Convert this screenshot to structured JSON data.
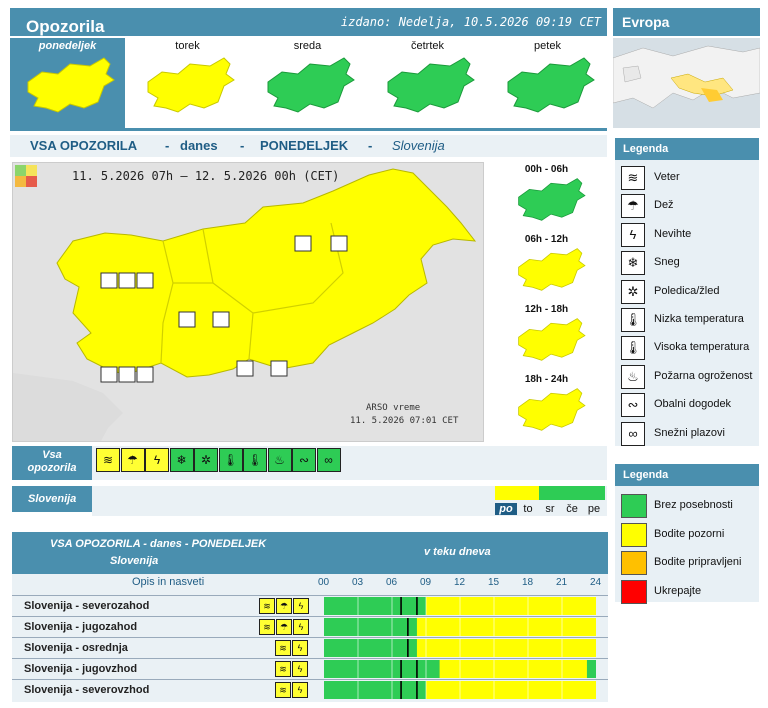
{
  "header": {
    "title": "Opozorila",
    "issued": "izdano: Nedelja, 10.5.2026 09:19 CET",
    "europe": "Evropa"
  },
  "days": [
    {
      "label": "ponedeljek",
      "level": "yellow"
    },
    {
      "label": "torek",
      "level": "yellow"
    },
    {
      "label": "sreda",
      "level": "green"
    },
    {
      "label": "četrtek",
      "level": "green"
    },
    {
      "label": "petek",
      "level": "green"
    }
  ],
  "region_header": {
    "a": "VSA OPOZORILA",
    "dash1": "-",
    "b": "danes",
    "dash2": "-",
    "c": "PONEDELJEK",
    "dash3": "-",
    "d": "Slovenija"
  },
  "map": {
    "period": "11. 5.2026 07h — 12. 5.2026 00h    (CET)",
    "source": "ARSO vreme",
    "source_time": "11. 5.2026  07:01 CET"
  },
  "slices": [
    {
      "label": "00h - 06h",
      "level": "green"
    },
    {
      "label": "06h - 12h",
      "level": "yellow"
    },
    {
      "label": "12h - 18h",
      "level": "yellow"
    },
    {
      "label": "18h - 24h",
      "level": "yellow"
    }
  ],
  "legend_types": {
    "title": "Legenda",
    "items": [
      {
        "icon": "wind-icon",
        "glyph": "≋",
        "label": "Veter"
      },
      {
        "icon": "rain-icon",
        "glyph": "☂",
        "label": "Dež"
      },
      {
        "icon": "thunderstorm-icon",
        "glyph": "ϟ",
        "label": "Nevihte"
      },
      {
        "icon": "snow-icon",
        "glyph": "❄",
        "label": "Sneg"
      },
      {
        "icon": "ice-icon",
        "glyph": "✲",
        "label": "Poledica/žled"
      },
      {
        "icon": "low-temp-icon",
        "glyph": "🌡",
        "label": "Nizka temperatura"
      },
      {
        "icon": "high-temp-icon",
        "glyph": "🌡",
        "label": "Visoka temperatura"
      },
      {
        "icon": "fire-icon",
        "glyph": "♨",
        "label": "Požarna ogroženost"
      },
      {
        "icon": "coastal-icon",
        "glyph": "∾",
        "label": "Obalni dogodek"
      },
      {
        "icon": "avalanche-icon",
        "glyph": "∞",
        "label": "Snežni plazovi"
      }
    ]
  },
  "legend_levels": {
    "title": "Legenda",
    "items": [
      {
        "label": "Brez posebnosti",
        "color": "#2ecc55"
      },
      {
        "label": "Bodite pozorni",
        "color": "#ffff00"
      },
      {
        "label": "Bodite pripravljeni",
        "color": "#ffc000"
      },
      {
        "label": "Ukrepajte",
        "color": "#ff0000"
      }
    ]
  },
  "filters": {
    "all_label": "Vsa opozorila",
    "region_label": "Slovenija",
    "day_abbr": [
      "po",
      "to",
      "sr",
      "če",
      "pe"
    ],
    "day_colors": [
      "#ffff00",
      "#ffff00",
      "#2ecc55",
      "#2ecc55",
      "#2ecc55"
    ]
  },
  "table": {
    "title": "VSA OPOZORILA - danes - PONEDELJEK",
    "subtitle": "Slovenija",
    "col_header": "v teku dneva",
    "desc_header": "Opis in nasveti",
    "hours": [
      "00",
      "03",
      "06",
      "09",
      "12",
      "15",
      "18",
      "21",
      "24"
    ],
    "rows": [
      {
        "name": "Slovenija - severozahod",
        "icons": [
          "≋",
          "☂",
          "ϟ"
        ],
        "yellow_from": 9.0,
        "yellow_to": 24,
        "markers": [
          6.8,
          8.2
        ]
      },
      {
        "name": "Slovenija - jugozahod",
        "icons": [
          "≋",
          "☂",
          "ϟ"
        ],
        "yellow_from": 8.2,
        "yellow_to": 24,
        "markers": [
          7.4
        ]
      },
      {
        "name": "Slovenija - osrednja",
        "icons": [
          "≋",
          "ϟ"
        ],
        "yellow_from": 8.2,
        "yellow_to": 24,
        "markers": [
          7.4
        ]
      },
      {
        "name": "Slovenija - jugovzhod",
        "icons": [
          "≋",
          "ϟ"
        ],
        "yellow_from": 10.2,
        "yellow_to": 23.2,
        "markers": [
          6.8,
          8.2
        ]
      },
      {
        "name": "Slovenija - severovzhod",
        "icons": [
          "≋",
          "ϟ"
        ],
        "yellow_from": 9.0,
        "yellow_to": 24,
        "markers": [
          6.8,
          8.2
        ]
      }
    ]
  },
  "colors": {
    "accent": "#4a8fae",
    "green": "#2ecc55",
    "yellow": "#ffff00"
  }
}
